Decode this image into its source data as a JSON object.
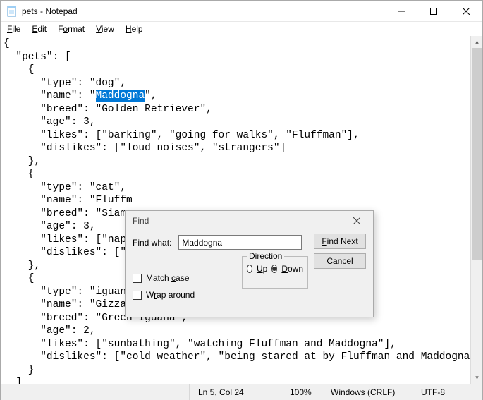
{
  "window": {
    "title": "pets - Notepad"
  },
  "menus": {
    "file": "File",
    "edit": "Edit",
    "format": "Format",
    "view": "View",
    "help": "Help"
  },
  "editor": {
    "pre_text": "{\n  \"pets\": [\n    {\n      \"type\": \"dog\",\n      \"name\": \"",
    "selected": "Maddogna",
    "post_selected": "\",\n      \"breed\": \"Golden Retriever\",\n      \"age\": 3,\n      \"likes\": [\"barking\", \"going for walks\", \"Fluffman\"],\n      \"dislikes\": [\"loud noises\", \"strangers\"]\n    },\n    {\n      \"type\": \"cat\",\n      \"name\": \"Fluffm\n      \"breed\": \"Siame\n      \"age\": 3,\n      \"likes\": [\"napp\n      \"dislikes\": [\"b\n    },\n    {\n      \"type\": \"iguana\n      \"name\": \"Gizzards the Great\",\n      \"breed\": \"Green Iguana\",\n      \"age\": 2,\n      \"likes\": [\"sunbathing\", \"watching Fluffman and Maddogna\"],\n      \"dislikes\": [\"cold weather\", \"being stared at by Fluffman and Maddogna\"]\n    }\n  ]"
  },
  "find": {
    "title": "Find",
    "label": "Find what:",
    "value": "Maddogna",
    "find_next": "Find Next",
    "cancel": "Cancel",
    "direction_label": "Direction",
    "up": "Up",
    "down": "Down",
    "match_case": "Match case",
    "wrap_around": "Wrap around"
  },
  "status": {
    "pos": "Ln 5, Col 24",
    "zoom": "100%",
    "eol": "Windows (CRLF)",
    "encoding": "UTF-8"
  }
}
